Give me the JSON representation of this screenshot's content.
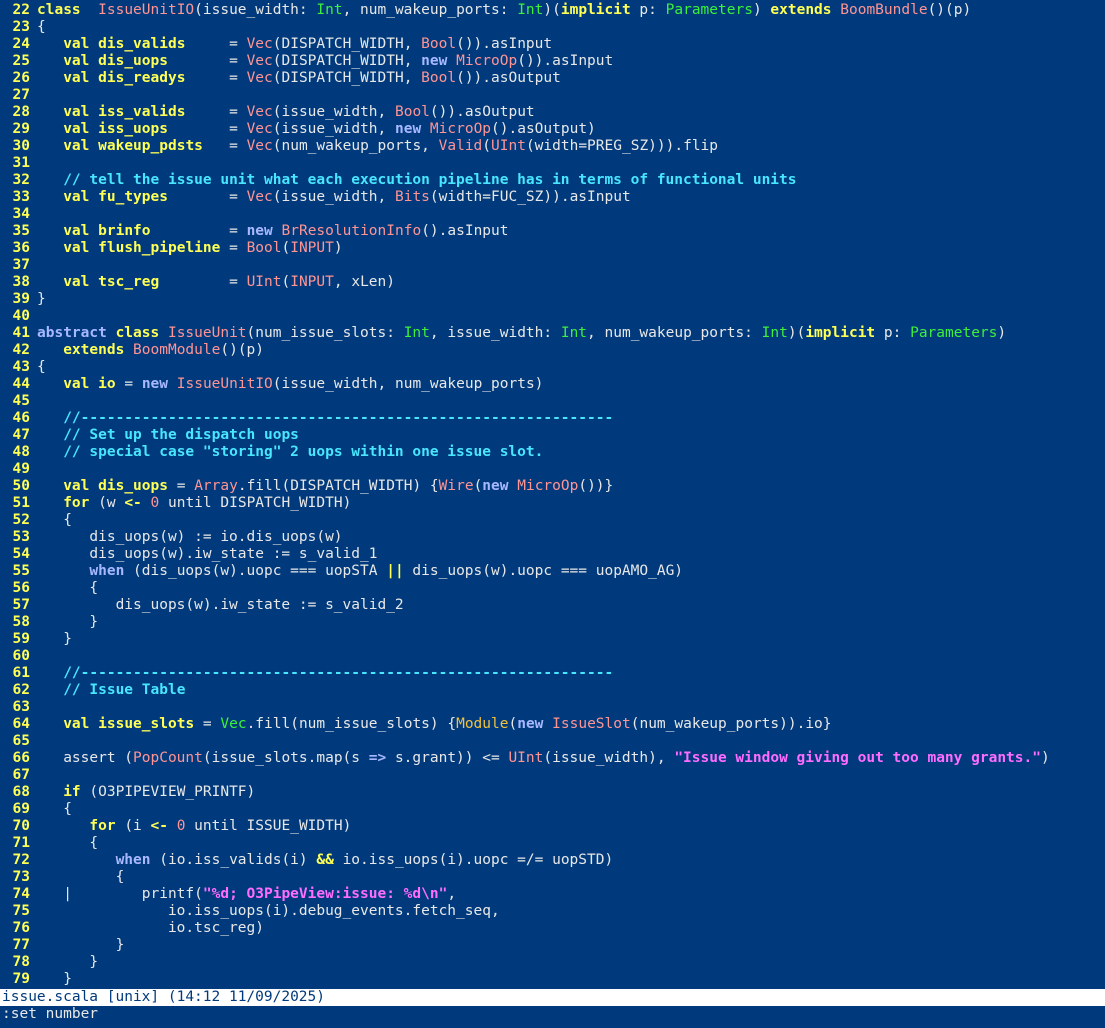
{
  "colors": {
    "background": "#013a7c",
    "line_number": "#ffff54",
    "keyword": "#ffff54",
    "keyword_alt": "#a8b8ff",
    "type": "#3cf03c",
    "function": "#ff9494",
    "comment": "#48e6ff",
    "string": "#ff6cff",
    "status_bg": "#ffffff",
    "status_fg": "#013a7c"
  },
  "editor": {
    "lines": [
      {
        "n": "22",
        "t": [
          [
            "kw",
            "class"
          ],
          [
            "",
            "  "
          ],
          [
            "fn",
            "IssueUnitIO"
          ],
          [
            "",
            "(issue_width: "
          ],
          [
            "ty",
            "Int"
          ],
          [
            "",
            ", num_wakeup_ports: "
          ],
          [
            "ty",
            "Int"
          ],
          [
            "",
            ")("
          ],
          [
            "kw",
            "implicit"
          ],
          [
            "",
            " p: "
          ],
          [
            "ty",
            "Parameters"
          ],
          [
            "",
            ") "
          ],
          [
            "kw",
            "extends"
          ],
          [
            "",
            " "
          ],
          [
            "fn",
            "BoomBundle"
          ],
          [
            "",
            "()(p)"
          ]
        ]
      },
      {
        "n": "23",
        "t": [
          [
            "",
            "{"
          ]
        ]
      },
      {
        "n": "24",
        "t": [
          [
            "",
            "   "
          ],
          [
            "kw",
            "val"
          ],
          [
            "",
            " "
          ],
          [
            "kw",
            "dis_valids"
          ],
          [
            "",
            "     = "
          ],
          [
            "fn",
            "Vec"
          ],
          [
            "",
            "(DISPATCH_WIDTH, "
          ],
          [
            "fn",
            "Bool"
          ],
          [
            "",
            "()).asInput"
          ]
        ]
      },
      {
        "n": "25",
        "t": [
          [
            "",
            "   "
          ],
          [
            "kw",
            "val"
          ],
          [
            "",
            " "
          ],
          [
            "kw",
            "dis_uops"
          ],
          [
            "",
            "       = "
          ],
          [
            "fn",
            "Vec"
          ],
          [
            "",
            "(DISPATCH_WIDTH, "
          ],
          [
            "kw2",
            "new"
          ],
          [
            "",
            " "
          ],
          [
            "fn",
            "MicroOp"
          ],
          [
            "",
            "()).asInput"
          ]
        ]
      },
      {
        "n": "26",
        "t": [
          [
            "",
            "   "
          ],
          [
            "kw",
            "val"
          ],
          [
            "",
            " "
          ],
          [
            "kw",
            "dis_readys"
          ],
          [
            "",
            "     = "
          ],
          [
            "fn",
            "Vec"
          ],
          [
            "",
            "(DISPATCH_WIDTH, "
          ],
          [
            "fn",
            "Bool"
          ],
          [
            "",
            "()).asOutput"
          ]
        ]
      },
      {
        "n": "27",
        "t": []
      },
      {
        "n": "28",
        "t": [
          [
            "",
            "   "
          ],
          [
            "kw",
            "val"
          ],
          [
            "",
            " "
          ],
          [
            "kw",
            "iss_valids"
          ],
          [
            "",
            "     = "
          ],
          [
            "fn",
            "Vec"
          ],
          [
            "",
            "(issue_width, "
          ],
          [
            "fn",
            "Bool"
          ],
          [
            "",
            "()).asOutput"
          ]
        ]
      },
      {
        "n": "29",
        "t": [
          [
            "",
            "   "
          ],
          [
            "kw",
            "val"
          ],
          [
            "",
            " "
          ],
          [
            "kw",
            "iss_uops"
          ],
          [
            "",
            "       = "
          ],
          [
            "fn",
            "Vec"
          ],
          [
            "",
            "(issue_width, "
          ],
          [
            "kw2",
            "new"
          ],
          [
            "",
            " "
          ],
          [
            "fn",
            "MicroOp"
          ],
          [
            "",
            "().asOutput)"
          ]
        ]
      },
      {
        "n": "30",
        "t": [
          [
            "",
            "   "
          ],
          [
            "kw",
            "val"
          ],
          [
            "",
            " "
          ],
          [
            "kw",
            "wakeup_pdsts"
          ],
          [
            "",
            "   = "
          ],
          [
            "fn",
            "Vec"
          ],
          [
            "",
            "(num_wakeup_ports, "
          ],
          [
            "fn",
            "Valid"
          ],
          [
            "",
            "("
          ],
          [
            "fn",
            "UInt"
          ],
          [
            "",
            "(width=PREG_SZ))).flip"
          ]
        ]
      },
      {
        "n": "31",
        "t": []
      },
      {
        "n": "32",
        "t": [
          [
            "",
            "   "
          ],
          [
            "cm",
            "// tell the issue unit what each execution pipeline has in terms of functional units"
          ]
        ]
      },
      {
        "n": "33",
        "t": [
          [
            "",
            "   "
          ],
          [
            "kw",
            "val"
          ],
          [
            "",
            " "
          ],
          [
            "kw",
            "fu_types"
          ],
          [
            "",
            "       = "
          ],
          [
            "fn",
            "Vec"
          ],
          [
            "",
            "(issue_width, "
          ],
          [
            "fn",
            "Bits"
          ],
          [
            "",
            "(width=FUC_SZ)).asInput"
          ]
        ]
      },
      {
        "n": "34",
        "t": []
      },
      {
        "n": "35",
        "t": [
          [
            "",
            "   "
          ],
          [
            "kw",
            "val"
          ],
          [
            "",
            " "
          ],
          [
            "kw",
            "brinfo"
          ],
          [
            "",
            "         = "
          ],
          [
            "kw2",
            "new"
          ],
          [
            "",
            " "
          ],
          [
            "fn",
            "BrResolutionInfo"
          ],
          [
            "",
            "().asInput"
          ]
        ]
      },
      {
        "n": "36",
        "t": [
          [
            "",
            "   "
          ],
          [
            "kw",
            "val"
          ],
          [
            "",
            " "
          ],
          [
            "kw",
            "flush_pipeline"
          ],
          [
            "",
            " = "
          ],
          [
            "fn",
            "Bool"
          ],
          [
            "",
            "("
          ],
          [
            "fn",
            "INPUT"
          ],
          [
            "",
            ")"
          ]
        ]
      },
      {
        "n": "37",
        "t": []
      },
      {
        "n": "38",
        "t": [
          [
            "",
            "   "
          ],
          [
            "kw",
            "val"
          ],
          [
            "",
            " "
          ],
          [
            "kw",
            "tsc_reg"
          ],
          [
            "",
            "        = "
          ],
          [
            "fn",
            "UInt"
          ],
          [
            "",
            "("
          ],
          [
            "fn",
            "INPUT"
          ],
          [
            "",
            ", xLen)"
          ]
        ]
      },
      {
        "n": "39",
        "t": [
          [
            "",
            "}"
          ]
        ]
      },
      {
        "n": "40",
        "t": []
      },
      {
        "n": "41",
        "t": [
          [
            "kw2",
            "abstract"
          ],
          [
            "",
            " "
          ],
          [
            "kw",
            "class"
          ],
          [
            "",
            " "
          ],
          [
            "fn",
            "IssueUnit"
          ],
          [
            "",
            "(num_issue_slots: "
          ],
          [
            "ty",
            "Int"
          ],
          [
            "",
            ", issue_width: "
          ],
          [
            "ty",
            "Int"
          ],
          [
            "",
            ", num_wakeup_ports: "
          ],
          [
            "ty",
            "Int"
          ],
          [
            "",
            ")("
          ],
          [
            "kw",
            "implicit"
          ],
          [
            "",
            " p: "
          ],
          [
            "ty",
            "Parameters"
          ],
          [
            "",
            ")"
          ]
        ]
      },
      {
        "n": "42",
        "t": [
          [
            "",
            "   "
          ],
          [
            "kw",
            "extends"
          ],
          [
            "",
            " "
          ],
          [
            "fn",
            "BoomModule"
          ],
          [
            "",
            "()(p)"
          ]
        ]
      },
      {
        "n": "43",
        "t": [
          [
            "",
            "{"
          ]
        ]
      },
      {
        "n": "44",
        "t": [
          [
            "",
            "   "
          ],
          [
            "kw",
            "val"
          ],
          [
            "",
            " "
          ],
          [
            "kw",
            "io"
          ],
          [
            "",
            " = "
          ],
          [
            "kw2",
            "new"
          ],
          [
            "",
            " "
          ],
          [
            "fn",
            "IssueUnitIO"
          ],
          [
            "",
            "(issue_width, num_wakeup_ports)"
          ]
        ]
      },
      {
        "n": "45",
        "t": []
      },
      {
        "n": "46",
        "t": [
          [
            "",
            "   "
          ],
          [
            "cm",
            "//-------------------------------------------------------------"
          ]
        ]
      },
      {
        "n": "47",
        "t": [
          [
            "",
            "   "
          ],
          [
            "cm",
            "// Set up the dispatch uops"
          ]
        ]
      },
      {
        "n": "48",
        "t": [
          [
            "",
            "   "
          ],
          [
            "cm",
            "// special case \"storing\" 2 uops within one issue slot."
          ]
        ]
      },
      {
        "n": "49",
        "t": []
      },
      {
        "n": "50",
        "t": [
          [
            "",
            "   "
          ],
          [
            "kw",
            "val"
          ],
          [
            "",
            " "
          ],
          [
            "kw",
            "dis_uops"
          ],
          [
            "",
            " = "
          ],
          [
            "fn",
            "Array"
          ],
          [
            "",
            ".fill(DISPATCH_WIDTH) {"
          ],
          [
            "fn",
            "Wire"
          ],
          [
            "",
            "("
          ],
          [
            "kw2",
            "new"
          ],
          [
            "",
            " "
          ],
          [
            "fn",
            "MicroOp"
          ],
          [
            "",
            "())}"
          ]
        ]
      },
      {
        "n": "51",
        "t": [
          [
            "",
            "   "
          ],
          [
            "kw",
            "for"
          ],
          [
            "",
            " (w "
          ],
          [
            "op",
            "<-"
          ],
          [
            "",
            " "
          ],
          [
            "fn",
            "0"
          ],
          [
            "",
            " until DISPATCH_WIDTH)"
          ]
        ]
      },
      {
        "n": "52",
        "t": [
          [
            "",
            "   {"
          ]
        ]
      },
      {
        "n": "53",
        "t": [
          [
            "",
            "      dis_uops(w) := io.dis_uops(w)"
          ]
        ]
      },
      {
        "n": "54",
        "t": [
          [
            "",
            "      dis_uops(w).iw_state := s_valid_1"
          ]
        ]
      },
      {
        "n": "55",
        "t": [
          [
            "",
            "      "
          ],
          [
            "kw2",
            "when"
          ],
          [
            "",
            " (dis_uops(w).uopc === uopSTA "
          ],
          [
            "op",
            "||"
          ],
          [
            "",
            " dis_uops(w).uopc === uopAMO_AG)"
          ]
        ]
      },
      {
        "n": "56",
        "t": [
          [
            "",
            "      {"
          ]
        ]
      },
      {
        "n": "57",
        "t": [
          [
            "",
            "         dis_uops(w).iw_state := s_valid_2"
          ]
        ]
      },
      {
        "n": "58",
        "t": [
          [
            "",
            "      }"
          ]
        ]
      },
      {
        "n": "59",
        "t": [
          [
            "",
            "   }"
          ]
        ]
      },
      {
        "n": "60",
        "t": []
      },
      {
        "n": "61",
        "t": [
          [
            "",
            "   "
          ],
          [
            "cm",
            "//-------------------------------------------------------------"
          ]
        ]
      },
      {
        "n": "62",
        "t": [
          [
            "",
            "   "
          ],
          [
            "cm",
            "// Issue Table"
          ]
        ]
      },
      {
        "n": "63",
        "t": []
      },
      {
        "n": "64",
        "t": [
          [
            "",
            "   "
          ],
          [
            "kw",
            "val"
          ],
          [
            "",
            " "
          ],
          [
            "kw",
            "issue_slots"
          ],
          [
            "",
            " = "
          ],
          [
            "ty",
            "Vec"
          ],
          [
            "",
            ".fill(num_issue_slots) {"
          ],
          [
            "tp",
            "Module"
          ],
          [
            "",
            "("
          ],
          [
            "kw2",
            "new"
          ],
          [
            "",
            " "
          ],
          [
            "fn",
            "IssueSlot"
          ],
          [
            "",
            "(num_wakeup_ports)).io}"
          ]
        ]
      },
      {
        "n": "65",
        "t": []
      },
      {
        "n": "66",
        "t": [
          [
            "",
            "   assert ("
          ],
          [
            "fn",
            "PopCount"
          ],
          [
            "",
            "(issue_slots.map(s "
          ],
          [
            "kw2",
            "=>"
          ],
          [
            "",
            " s.grant)) <= "
          ],
          [
            "fn",
            "UInt"
          ],
          [
            "",
            "(issue_width), "
          ],
          [
            "str",
            "\"Issue window giving out too many grants.\""
          ],
          [
            "",
            ")"
          ]
        ]
      },
      {
        "n": "67",
        "t": []
      },
      {
        "n": "68",
        "t": [
          [
            "",
            "   "
          ],
          [
            "kw",
            "if"
          ],
          [
            "",
            " (O3PIPEVIEW_PRINTF)"
          ]
        ]
      },
      {
        "n": "69",
        "t": [
          [
            "",
            "   {"
          ]
        ]
      },
      {
        "n": "70",
        "t": [
          [
            "",
            "      "
          ],
          [
            "kw",
            "for"
          ],
          [
            "",
            " (i "
          ],
          [
            "op",
            "<-"
          ],
          [
            "",
            " "
          ],
          [
            "fn",
            "0"
          ],
          [
            "",
            " until ISSUE_WIDTH)"
          ]
        ]
      },
      {
        "n": "71",
        "t": [
          [
            "",
            "      {"
          ]
        ]
      },
      {
        "n": "72",
        "t": [
          [
            "",
            "         "
          ],
          [
            "kw2",
            "when"
          ],
          [
            "",
            " (io.iss_valids(i) "
          ],
          [
            "op",
            "&&"
          ],
          [
            "",
            " io.iss_uops(i).uopc =/= uopSTD)"
          ]
        ]
      },
      {
        "n": "73",
        "t": [
          [
            "",
            "         {"
          ]
        ]
      },
      {
        "n": "74",
        "t": [
          [
            "",
            "   |        printf("
          ],
          [
            "str",
            "\"%d; O3PipeView:issue: %d\\n\""
          ],
          [
            "",
            ","
          ]
        ]
      },
      {
        "n": "75",
        "t": [
          [
            "",
            "               io.iss_uops(i).debug_events.fetch_seq,"
          ]
        ]
      },
      {
        "n": "76",
        "t": [
          [
            "",
            "               io.tsc_reg)"
          ]
        ]
      },
      {
        "n": "77",
        "t": [
          [
            "",
            "         }"
          ]
        ]
      },
      {
        "n": "78",
        "t": [
          [
            "",
            "      }"
          ]
        ]
      },
      {
        "n": "79",
        "t": [
          [
            "",
            "   }"
          ]
        ]
      }
    ]
  },
  "status": {
    "text": "issue.scala [unix] (14:12 11/09/2025)"
  },
  "cmdline": {
    "text": ":set number"
  }
}
